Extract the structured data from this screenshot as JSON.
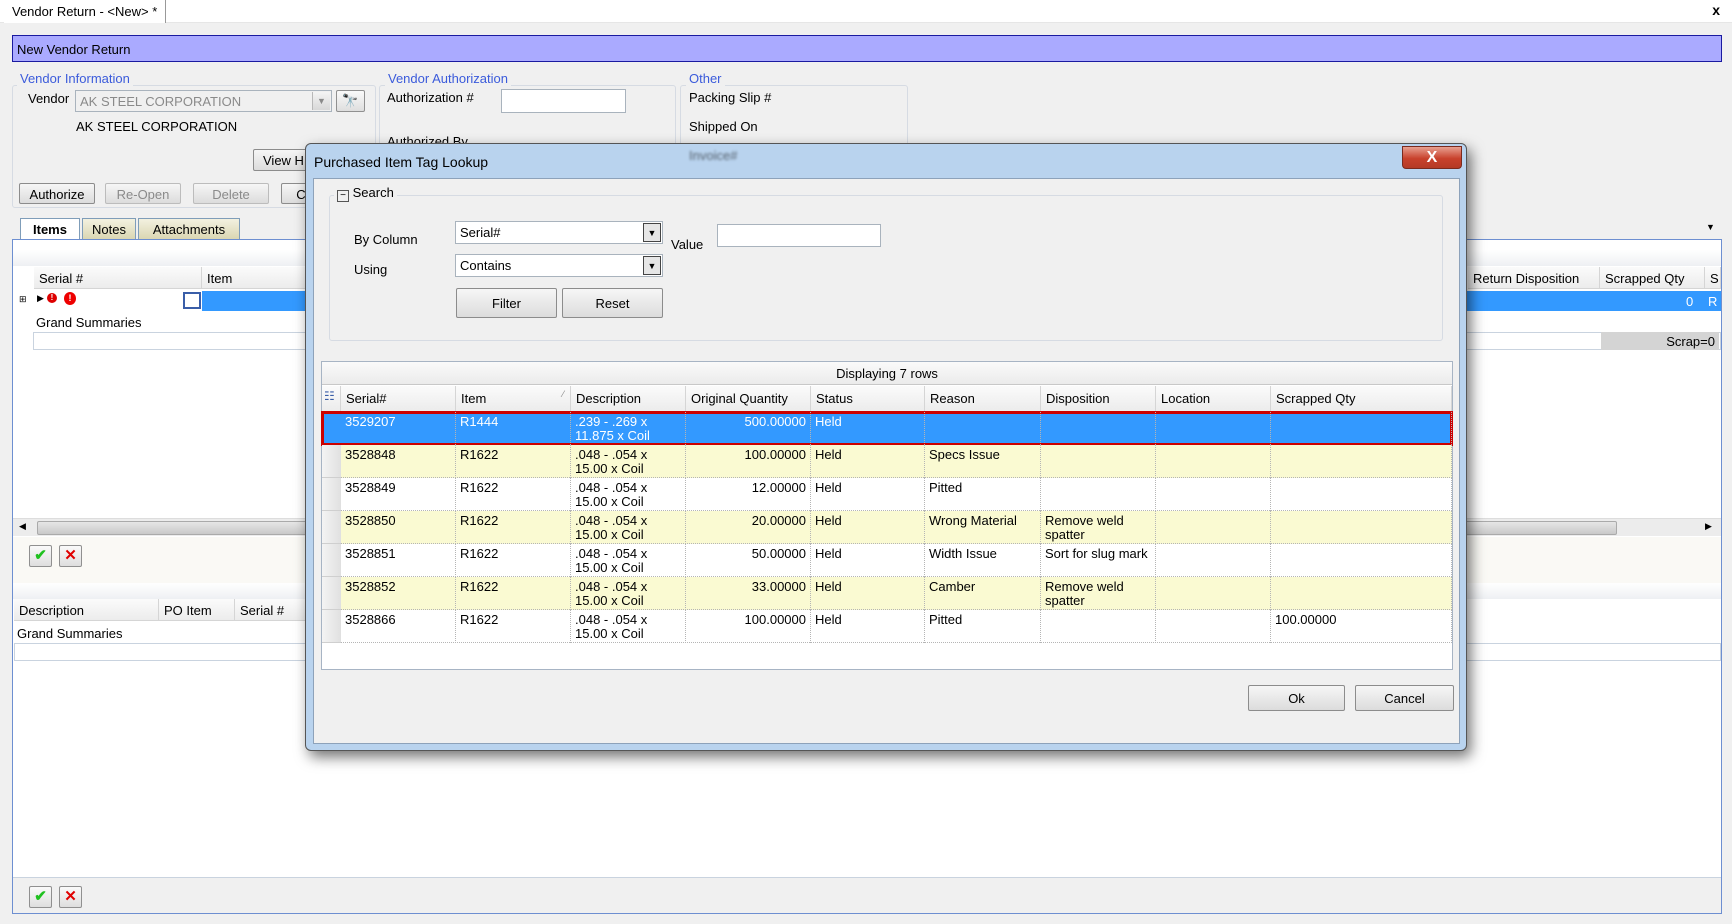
{
  "window": {
    "tab_title": "Vendor Return - <New> *",
    "close_label": "x"
  },
  "header": {
    "title": "New Vendor Return"
  },
  "vendor_info": {
    "legend": "Vendor Information",
    "vendor_label": "Vendor",
    "vendor_value": "AK STEEL CORPORATION",
    "vendor_name": "AK STEEL CORPORATION",
    "view_button": "View H"
  },
  "vendor_auth": {
    "legend": "Vendor Authorization",
    "auth_label": "Authorization #",
    "auth_value": "",
    "authorized_by_label": "Authorized By"
  },
  "other": {
    "legend": "Other",
    "packing_slip_label": "Packing Slip #",
    "shipped_on_label": "Shipped On",
    "invoice_label": "Invoice#"
  },
  "actions": {
    "authorize": "Authorize",
    "reopen": "Re-Open",
    "delete": "Delete",
    "fourth": "C"
  },
  "tabs": [
    {
      "label": "Items",
      "active": true
    },
    {
      "label": "Notes"
    },
    {
      "label": "Attachments"
    }
  ],
  "items_grid": {
    "columns_left": [
      "Serial #",
      "Item"
    ],
    "columns_right": [
      "Return Disposition",
      "Scrapped Qty",
      "S"
    ],
    "row": {
      "scrapped_qty": "0",
      "s": "R"
    },
    "grand_summaries": "Grand Summaries",
    "scrap_summary": "Scrap=0"
  },
  "bottom_grid": {
    "columns": [
      "Description",
      "PO Item",
      "Serial #"
    ],
    "grand_summaries": "Grand Summaries"
  },
  "dialog": {
    "title": "Purchased Item Tag Lookup",
    "close_label": "X",
    "search": {
      "legend": "Search",
      "by_column_label": "By Column",
      "by_column_value": "Serial#",
      "value_label": "Value",
      "value": "",
      "using_label": "Using",
      "using_value": "Contains",
      "filter": "Filter",
      "reset": "Reset"
    },
    "grid": {
      "status": "Displaying 7 rows",
      "columns": [
        "Serial#",
        "Item",
        "Description",
        "Original Quantity",
        "Status",
        "Reason",
        "Disposition",
        "Location",
        "Scrapped Qty"
      ],
      "rows": [
        {
          "serial": "3529207",
          "item": "R1444",
          "desc1": ".239 - .269 x",
          "desc2": "11.875 x Coil",
          "qty": "500.00000",
          "status": "Held",
          "reason": "",
          "disposition": "",
          "location": "",
          "scrapped": "",
          "selected": true
        },
        {
          "serial": "3528848",
          "item": "R1622",
          "desc1": ".048 - .054  x",
          "desc2": "15.00 x Coil",
          "qty": "100.00000",
          "status": "Held",
          "reason": "Specs Issue",
          "disposition": "",
          "location": "",
          "scrapped": ""
        },
        {
          "serial": "3528849",
          "item": "R1622",
          "desc1": ".048 - .054  x",
          "desc2": "15.00 x Coil",
          "qty": "12.00000",
          "status": "Held",
          "reason": "Pitted",
          "disposition": "",
          "location": "",
          "scrapped": ""
        },
        {
          "serial": "3528850",
          "item": "R1622",
          "desc1": ".048 - .054  x",
          "desc2": "15.00 x Coil",
          "qty": "20.00000",
          "status": "Held",
          "reason": "Wrong Material",
          "disposition": "Remove weld spatter",
          "location": "",
          "scrapped": ""
        },
        {
          "serial": "3528851",
          "item": "R1622",
          "desc1": ".048 - .054  x",
          "desc2": "15.00 x Coil",
          "qty": "50.00000",
          "status": "Held",
          "reason": "Width Issue",
          "disposition": "Sort for slug mark",
          "location": "",
          "scrapped": ""
        },
        {
          "serial": "3528852",
          "item": "R1622",
          "desc1": ".048 - .054  x",
          "desc2": "15.00 x Coil",
          "qty": "33.00000",
          "status": "Held",
          "reason": "Camber",
          "disposition": "Remove weld spatter",
          "location": "",
          "scrapped": ""
        },
        {
          "serial": "3528866",
          "item": "R1622",
          "desc1": ".048 - .054  x",
          "desc2": "15.00 x Coil",
          "qty": "100.00000",
          "status": "Held",
          "reason": "Pitted",
          "disposition": "",
          "location": "",
          "scrapped": "100.00000"
        }
      ]
    },
    "ok": "Ok",
    "cancel": "Cancel"
  },
  "colors": {
    "header_bg": "#aaaaff",
    "selection": "#3399ff",
    "alt_row": "#fafad2",
    "selected_border": "#cc0000"
  }
}
